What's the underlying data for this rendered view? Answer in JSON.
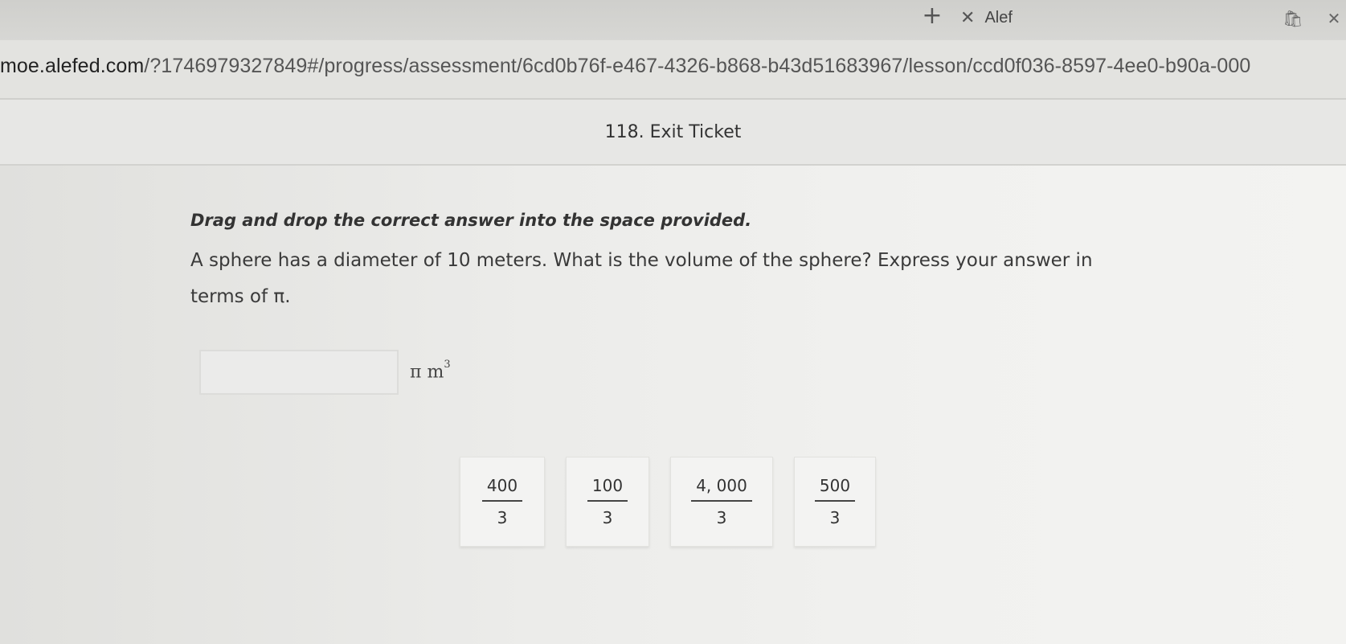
{
  "browser": {
    "new_tab_icon": "plus-icon",
    "tab": {
      "close_glyph": "✕",
      "title": "Alef"
    },
    "window_btn_a": "🛍",
    "window_btn_b": "✕",
    "address": {
      "host": "moe.alefed.com",
      "path": "/?1746979327849#/progress/assessment/6cd0b76f-e467-4326-b868-b43d51683967/lesson/ccd0f036-8597-4ee0-b90a-000"
    }
  },
  "header": {
    "lesson_title": "118. Exit Ticket"
  },
  "question": {
    "instruction": "Drag and drop the correct answer into the space provided.",
    "text": "A sphere has a diameter of 10 meters. What is the volume of the sphere? Express your answer in terms of π.",
    "answer_unit": "π m",
    "answer_unit_exp": "3"
  },
  "options": [
    {
      "numerator": "400",
      "denominator": "3"
    },
    {
      "numerator": "100",
      "denominator": "3"
    },
    {
      "numerator": "4, 000",
      "denominator": "3"
    },
    {
      "numerator": "500",
      "denominator": "3"
    }
  ]
}
